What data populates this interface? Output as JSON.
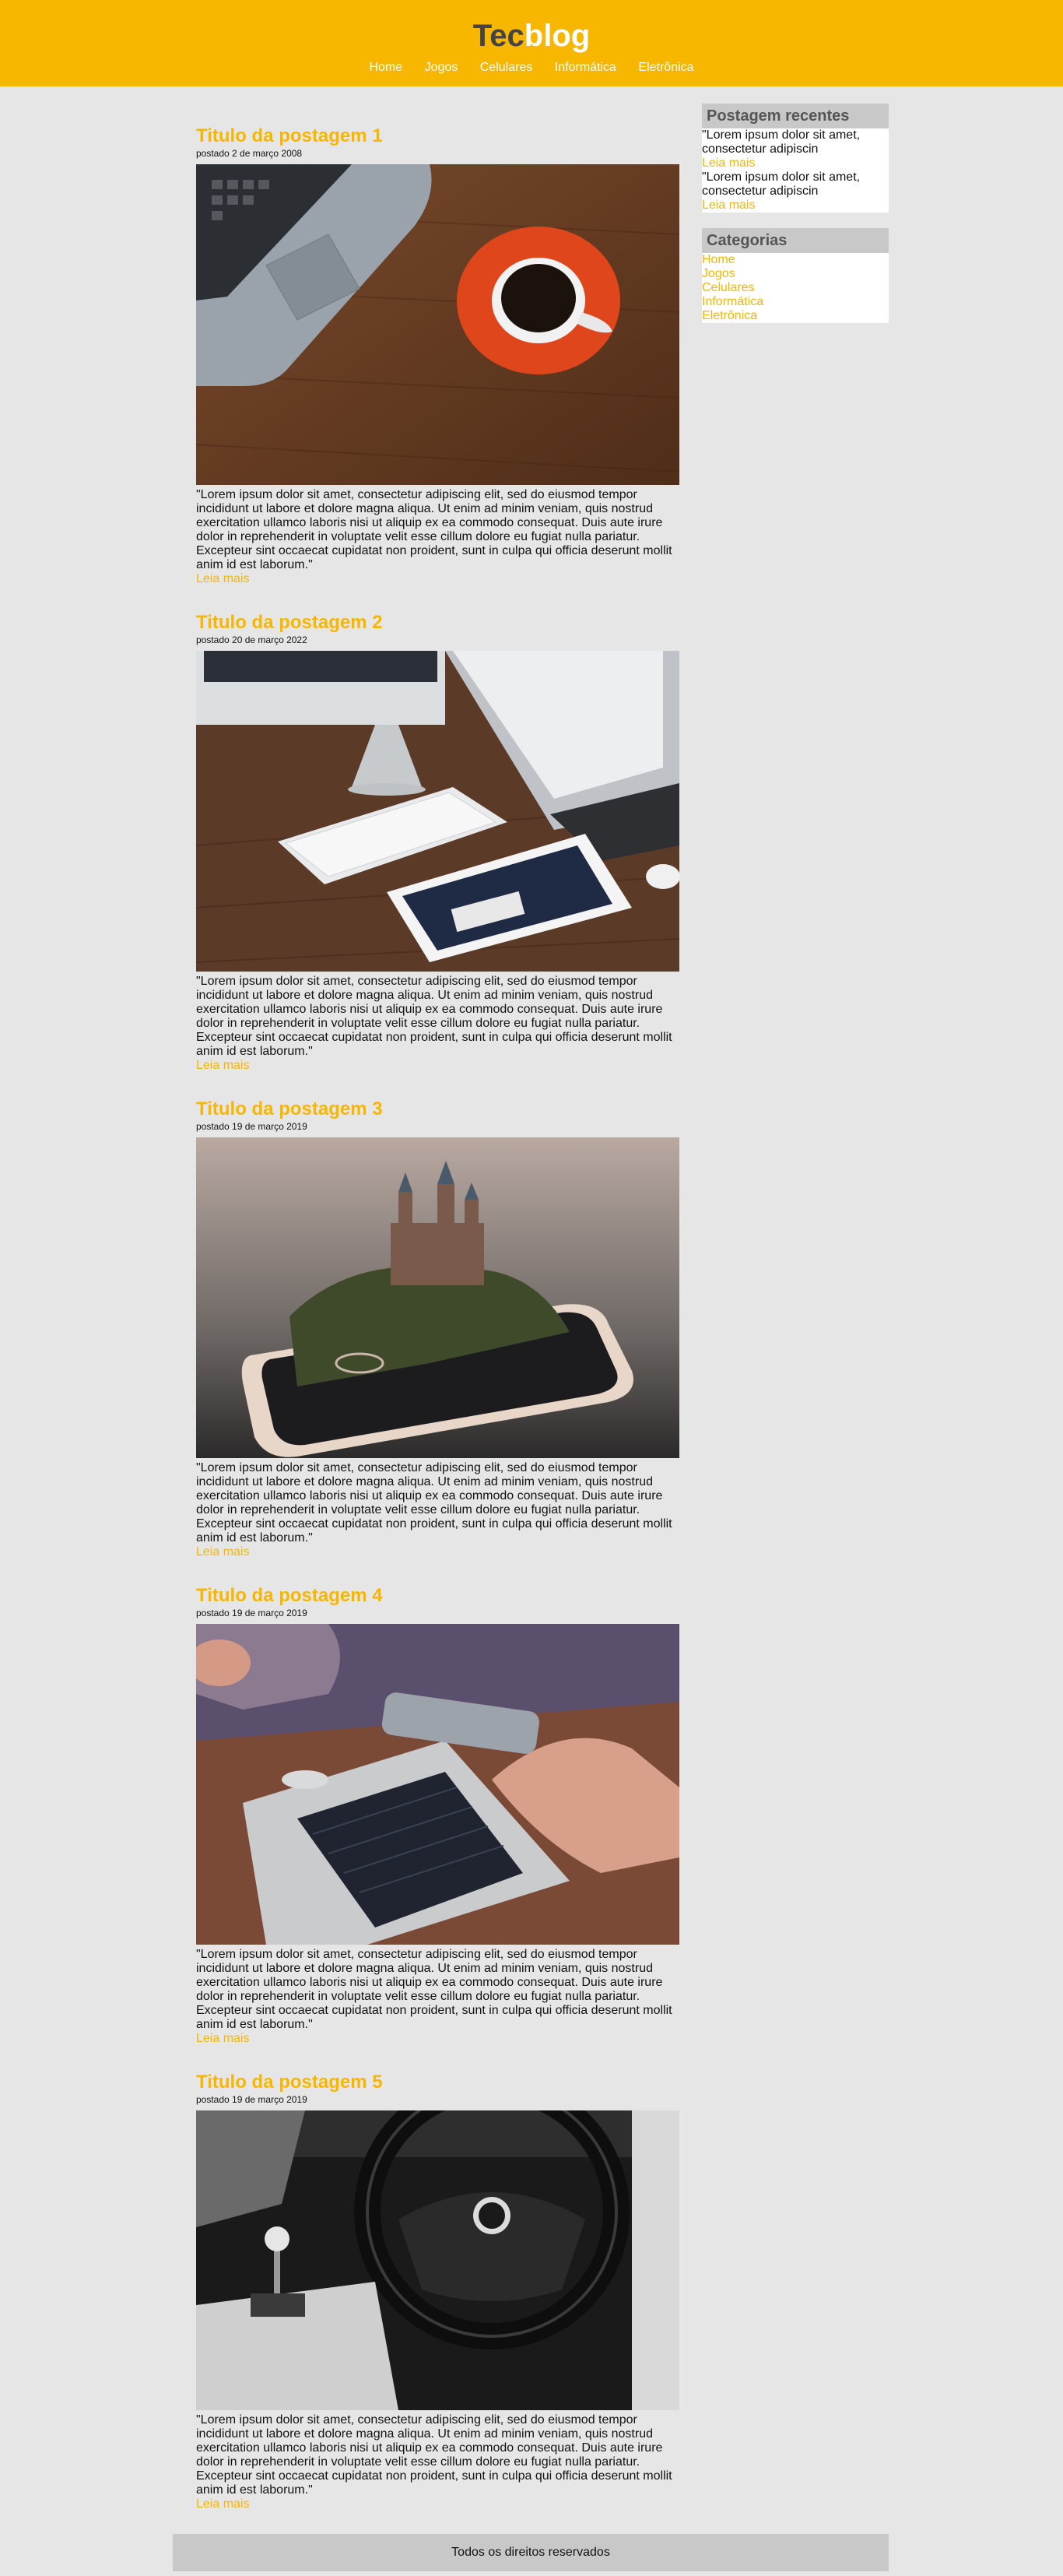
{
  "brand": {
    "part1": "Tec",
    "part2": "blog"
  },
  "nav": [
    "Home",
    "Jogos",
    "Celulares",
    "Informática",
    "Eletrônica"
  ],
  "posts": [
    {
      "title": "Titulo da postagem 1",
      "date": "postado 2 de março 2008",
      "body": "\"Lorem ipsum dolor sit amet, consectetur adipiscing elit, sed do eiusmod tempor incididunt ut labore et dolore magna aliqua. Ut enim ad minim veniam, quis nostrud exercitation ullamco laboris nisi ut aliquip ex ea commodo consequat. Duis aute irure dolor in reprehenderit in voluptate velit esse cillum dolore eu fugiat nulla pariatur. Excepteur sint occaecat cupidatat non proident, sunt in culpa qui officia deserunt mollit anim id est laborum.\"",
      "more": "Leia mais"
    },
    {
      "title": "Titulo da postagem 2",
      "date": "postado 20 de março 2022",
      "body": "\"Lorem ipsum dolor sit amet, consectetur adipiscing elit, sed do eiusmod tempor incididunt ut labore et dolore magna aliqua. Ut enim ad minim veniam, quis nostrud exercitation ullamco laboris nisi ut aliquip ex ea commodo consequat. Duis aute irure dolor in reprehenderit in voluptate velit esse cillum dolore eu fugiat nulla pariatur. Excepteur sint occaecat cupidatat non proident, sunt in culpa qui officia deserunt mollit anim id est laborum.\"",
      "more": "Leia mais"
    },
    {
      "title": "Titulo da postagem 3",
      "date": "postado 19 de março 2019",
      "body": "\"Lorem ipsum dolor sit amet, consectetur adipiscing elit, sed do eiusmod tempor incididunt ut labore et dolore magna aliqua. Ut enim ad minim veniam, quis nostrud exercitation ullamco laboris nisi ut aliquip ex ea commodo consequat. Duis aute irure dolor in reprehenderit in voluptate velit esse cillum dolore eu fugiat nulla pariatur. Excepteur sint occaecat cupidatat non proident, sunt in culpa qui officia deserunt mollit anim id est laborum.\"",
      "more": "Leia mais"
    },
    {
      "title": "Titulo da postagem 4",
      "date": "postado 19 de março 2019",
      "body": "\"Lorem ipsum dolor sit amet, consectetur adipiscing elit, sed do eiusmod tempor incididunt ut labore et dolore magna aliqua. Ut enim ad minim veniam, quis nostrud exercitation ullamco laboris nisi ut aliquip ex ea commodo consequat. Duis aute irure dolor in reprehenderit in voluptate velit esse cillum dolore eu fugiat nulla pariatur. Excepteur sint occaecat cupidatat non proident, sunt in culpa qui officia deserunt mollit anim id est laborum.\"",
      "more": "Leia mais"
    },
    {
      "title": "Titulo da postagem 5",
      "date": "postado 19 de março 2019",
      "body": "\"Lorem ipsum dolor sit amet, consectetur adipiscing elit, sed do eiusmod tempor incididunt ut labore et dolore magna aliqua. Ut enim ad minim veniam, quis nostrud exercitation ullamco laboris nisi ut aliquip ex ea commodo consequat. Duis aute irure dolor in reprehenderit in voluptate velit esse cillum dolore eu fugiat nulla pariatur. Excepteur sint occaecat cupidatat non proident, sunt in culpa qui officia deserunt mollit anim id est laborum.\"",
      "more": "Leia mais"
    }
  ],
  "sidebar": {
    "recent_title": "Postagem recentes",
    "recent": [
      {
        "text": "\"Lorem ipsum dolor sit amet, consectetur adipiscin",
        "more": "Leia mais"
      },
      {
        "text": "\"Lorem ipsum dolor sit amet, consectetur adipiscin",
        "more": "Leia mais"
      }
    ],
    "categories_title": "Categorias",
    "categories": [
      "Home",
      "Jogos",
      "Celulares",
      "Informática",
      "Eletrônica"
    ]
  },
  "footer": "Todos os direitos reservados",
  "colors": {
    "accent": "#f7b600",
    "background": "#e6e6e6",
    "dark": "#444444"
  }
}
